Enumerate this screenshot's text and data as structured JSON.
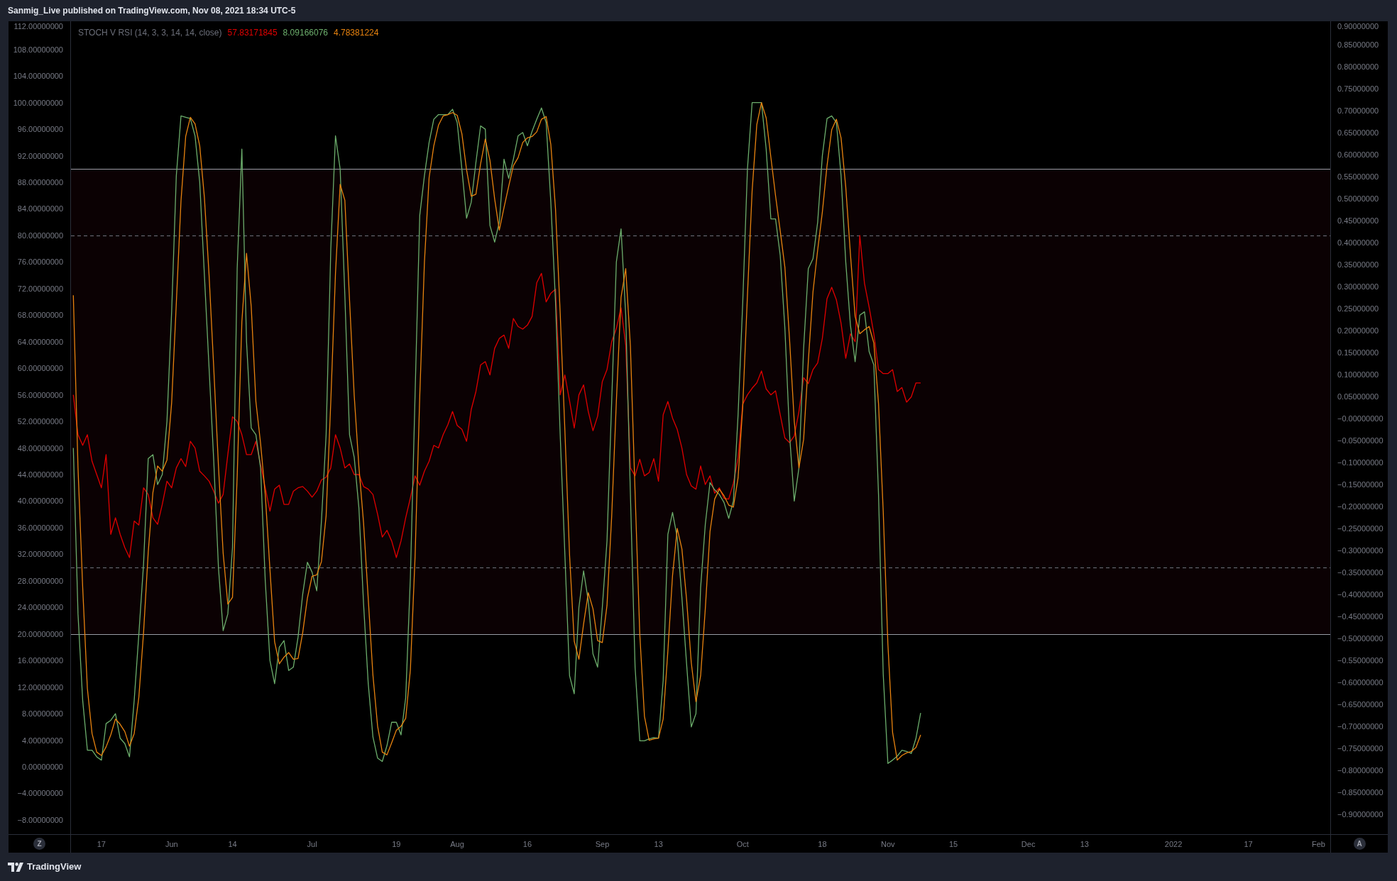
{
  "header": {
    "text": "Sanmig_Live published on TradingView.com, Nov 08, 2021 18:34 UTC-5"
  },
  "chart": {
    "legend_values": [
      "57.83171845",
      "8.09166076",
      "4.78381224"
    ],
    "axis_buttons": [
      "Z",
      "A"
    ],
    "right_scale": {
      "ticks": [
        "0.90000000",
        "0.85000000",
        "0.80000000",
        "0.75000000",
        "0.70000000",
        "0.65000000",
        "0.60000000",
        "0.55000000",
        "0.50000000",
        "0.45000000",
        "0.40000000",
        "0.35000000",
        "0.30000000",
        "0.25000000",
        "0.20000000",
        "0.15000000",
        "0.10000000",
        "0.05000000",
        "−0.00000000",
        "−0.05000000",
        "−0.10000000",
        "−0.15000000",
        "−0.20000000",
        "−0.25000000",
        "−0.30000000",
        "−0.35000000",
        "−0.40000000",
        "−0.45000000",
        "−0.50000000",
        "−0.55000000",
        "−0.60000000",
        "−0.65000000",
        "−0.70000000",
        "−0.75000000",
        "−0.80000000",
        "−0.85000000",
        "−0.90000000"
      ]
    },
    "chart_data": {
      "type": "line",
      "title": "STOCH V RSI (14, 3, 3, 14, 14, close)",
      "categories": [
        null,
        null,
        null,
        null,
        null,
        null,
        "17",
        null,
        null,
        null,
        null,
        null,
        null,
        null,
        null,
        null,
        null,
        null,
        null,
        null,
        null,
        "Jun",
        null,
        null,
        null,
        null,
        null,
        null,
        null,
        null,
        null,
        null,
        null,
        null,
        "14",
        null,
        null,
        null,
        null,
        null,
        null,
        null,
        null,
        null,
        null,
        null,
        null,
        null,
        null,
        null,
        null,
        "Jul",
        null,
        null,
        null,
        null,
        null,
        null,
        null,
        null,
        null,
        null,
        null,
        null,
        null,
        null,
        null,
        null,
        null,
        "19",
        null,
        null,
        null,
        null,
        null,
        null,
        null,
        null,
        null,
        null,
        null,
        null,
        "Aug",
        null,
        null,
        null,
        null,
        null,
        null,
        null,
        null,
        null,
        null,
        null,
        null,
        null,
        null,
        "16",
        null,
        null,
        null,
        null,
        null,
        null,
        null,
        null,
        null,
        null,
        null,
        null,
        null,
        null,
        null,
        "Sep",
        null,
        null,
        null,
        null,
        null,
        null,
        null,
        null,
        null,
        null,
        null,
        "13",
        null,
        null,
        null,
        null,
        null,
        null,
        null,
        null,
        null,
        null,
        null,
        null,
        null,
        null,
        null,
        null,
        null,
        "Oct",
        null,
        null,
        null,
        null,
        null,
        null,
        null,
        null,
        null,
        null,
        null,
        null,
        null,
        null,
        null,
        null,
        "18",
        null,
        null,
        null,
        null,
        null,
        null,
        null,
        null,
        null,
        null,
        null,
        null,
        null,
        "Nov",
        null,
        null,
        null,
        null,
        null,
        null,
        null,
        null,
        null,
        null,
        null,
        null,
        null,
        "15",
        null,
        null,
        null,
        null,
        null,
        null,
        null,
        null,
        null,
        null,
        null,
        null,
        null,
        null,
        null,
        "Dec",
        null,
        null,
        null,
        null,
        null,
        null,
        null,
        null,
        null,
        null,
        null,
        "13",
        null,
        null,
        null,
        null,
        null,
        null,
        null,
        null,
        null,
        null,
        null,
        null,
        null,
        null,
        null,
        null,
        null,
        null,
        "2022",
        null,
        null,
        null,
        null,
        null,
        null,
        null,
        null,
        null,
        null,
        null,
        null,
        null,
        null,
        null,
        "17",
        null,
        null,
        null,
        null,
        null,
        null,
        null,
        null,
        null,
        null,
        null,
        null,
        null,
        null,
        "Feb",
        null,
        null
      ],
      "series": [
        {
          "color": "#e00000",
          "values": [
            56,
            50,
            48.4,
            50,
            46,
            44,
            42,
            47,
            35,
            37.5,
            35,
            33,
            31.5,
            37,
            36.4,
            42,
            41,
            37.5,
            36.5,
            39.5,
            43,
            42,
            45,
            46.4,
            45.2,
            49,
            48,
            44.5,
            43.8,
            43,
            41.5,
            39.7,
            41,
            47,
            52.7,
            52,
            50,
            47,
            47,
            49,
            45.5,
            42,
            38.5,
            41.8,
            42.4,
            39.5,
            39.5,
            41.5,
            42,
            42.2,
            41.5,
            40.6,
            41.5,
            43.2,
            43.6,
            45,
            50,
            48,
            45,
            45.6,
            44,
            44,
            42.2,
            41.8,
            41,
            38,
            34.6,
            35.6,
            34,
            31.5,
            34,
            37.5,
            40.5,
            43.8,
            42.4,
            44.5,
            46,
            48.4,
            48,
            50,
            51.5,
            53.5,
            51.4,
            50.8,
            49,
            53.8,
            56.5,
            60.5,
            61,
            59,
            63,
            64.5,
            65,
            63,
            67.5,
            66.3,
            65.9,
            66.5,
            67.8,
            72.9,
            74.3,
            70,
            71.3,
            71.9,
            56,
            59,
            55.1,
            51,
            56,
            57.5,
            53.5,
            50.6,
            52.8,
            58,
            59.8,
            64,
            66,
            69.1,
            63.5,
            45,
            43.8,
            46.3,
            43.8,
            44.3,
            46.4,
            43,
            53,
            55,
            52.5,
            50.8,
            48,
            44,
            42.3,
            41.8,
            45.3,
            42.5,
            43.8,
            41.2,
            42,
            40.4,
            40.3,
            42.7,
            46.5,
            54.6,
            56,
            57,
            57.8,
            59.6,
            56.9,
            56,
            56.6,
            53,
            49.5,
            48.8,
            49.8,
            53.5,
            58.6,
            57.7,
            59.8,
            60.8,
            64.5,
            70.5,
            72.2,
            70.3,
            66.8,
            61.5,
            65.2,
            64,
            80,
            72.8,
            69.2,
            65.2,
            59.8,
            59.2,
            59.2,
            59.8,
            56.5,
            57.1,
            54.9,
            55.7,
            57.8,
            57.8,
            null,
            null,
            null,
            null,
            null,
            null,
            null,
            null,
            null,
            null,
            null,
            null,
            null,
            null,
            null,
            null,
            null,
            null,
            null,
            null,
            null,
            null,
            null,
            null,
            null,
            null,
            null,
            null,
            null,
            null,
            null,
            null,
            null,
            null,
            null,
            null,
            null,
            null,
            null,
            null,
            null,
            null,
            null,
            null,
            null,
            null,
            null,
            null,
            null,
            null,
            null,
            null,
            null,
            null,
            null,
            null,
            null,
            null,
            null,
            null,
            null,
            null,
            null,
            null,
            null,
            null,
            null,
            null,
            null,
            null,
            null,
            null,
            null,
            null,
            null,
            null,
            null,
            null,
            null,
            null,
            null,
            null,
            null,
            null,
            null,
            null,
            null
          ]
        },
        {
          "color": "#6cae6c",
          "values": [
            48,
            23,
            10,
            2.5,
            2.5,
            1.5,
            1,
            6.5,
            7,
            8,
            4.3,
            3.5,
            1.5,
            10,
            20,
            30.5,
            46.4,
            47,
            42.5,
            44,
            52,
            68.5,
            89,
            98,
            97.8,
            97.6,
            95,
            88,
            74,
            60,
            46,
            30,
            20.5,
            23,
            33,
            75,
            93,
            64,
            51,
            50,
            45,
            28,
            16,
            12.5,
            18,
            19,
            14.5,
            15,
            19.5,
            26,
            30.8,
            29.3,
            26.5,
            37,
            50,
            78,
            95,
            90,
            71,
            50,
            46.6,
            39,
            24.5,
            12.5,
            4.5,
            1.3,
            0.8,
            3.2,
            6.7,
            6.7,
            4.8,
            10.4,
            28.5,
            56,
            83,
            89,
            94,
            97.5,
            98.2,
            98.2,
            98.2,
            99,
            97,
            90,
            82.6,
            85,
            91,
            96.5,
            96,
            81.5,
            79,
            82,
            91.5,
            88.6,
            91.5,
            95,
            95.5,
            93.5,
            95.7,
            97.5,
            99.2,
            97,
            85,
            70,
            50,
            32,
            13.7,
            11,
            24,
            29.5,
            25,
            17,
            15,
            24,
            34,
            55,
            76,
            81,
            68,
            41,
            15,
            3.9,
            3.9,
            4.2,
            4.4,
            4.3,
            13,
            35,
            38.3,
            34.5,
            25.5,
            15.5,
            6,
            8,
            27,
            36.5,
            42.8,
            41.7,
            41,
            39.8,
            37.4,
            40,
            53,
            70,
            90,
            100,
            100,
            100,
            93,
            82.5,
            82.5,
            77,
            66,
            50,
            40,
            45,
            63,
            75,
            76.5,
            82,
            92,
            97.6,
            98,
            97,
            89,
            76,
            66.5,
            61,
            68,
            68.5,
            62.5,
            60.5,
            41,
            14,
            0.5,
            1,
            1.6,
            2.5,
            2.3,
            2,
            4.3,
            8.1,
            null,
            null,
            null,
            null,
            null,
            null,
            null,
            null,
            null,
            null,
            null,
            null,
            null,
            null,
            null,
            null,
            null,
            null,
            null,
            null,
            null,
            null,
            null,
            null,
            null,
            null,
            null,
            null,
            null,
            null,
            null,
            null,
            null,
            null,
            null,
            null,
            null,
            null,
            null,
            null,
            null,
            null,
            null,
            null,
            null,
            null,
            null,
            null,
            null,
            null,
            null,
            null,
            null,
            null,
            null,
            null,
            null,
            null,
            null,
            null,
            null,
            null,
            null,
            null,
            null,
            null,
            null,
            null,
            null,
            null,
            null,
            null,
            null,
            null,
            null,
            null,
            null,
            null,
            null,
            null,
            null,
            null,
            null,
            null,
            null,
            null,
            null
          ]
        },
        {
          "color": "#e8830f",
          "values": [
            71,
            45,
            27,
            11.8,
            5,
            2.2,
            1.7,
            3,
            4.8,
            7.2,
            6.4,
            5.3,
            3.1,
            5,
            10.5,
            20.2,
            32.3,
            41.3,
            45.3,
            44.5,
            46.2,
            54.8,
            69.8,
            85.2,
            94.9,
            97.8,
            96.8,
            93.5,
            85.7,
            74,
            60,
            45.3,
            32.2,
            24.5,
            25.5,
            43.7,
            67,
            77.3,
            69.3,
            55,
            48.7,
            41,
            29.7,
            18.8,
            15.5,
            16.5,
            17.2,
            16.2,
            16.3,
            20.2,
            25.4,
            28.7,
            28.9,
            30.9,
            37.8,
            55,
            74.3,
            87.7,
            85.3,
            70.3,
            55.9,
            45.2,
            36.7,
            25.3,
            13.8,
            6.1,
            2.2,
            1.8,
            3.6,
            5.5,
            6.1,
            7.3,
            14.6,
            31.6,
            55.8,
            76,
            88.7,
            93.5,
            96.6,
            98,
            98.2,
            98.5,
            98.1,
            95.3,
            89.9,
            85.9,
            86.2,
            90.8,
            94.5,
            91.3,
            85.5,
            80.8,
            84.2,
            87.4,
            90.5,
            91.7,
            94,
            94.7,
            94.9,
            95.6,
            97.5,
            97.9,
            93.7,
            84,
            68.3,
            50.7,
            31.9,
            18.9,
            16.2,
            21.5,
            26.2,
            23.8,
            19,
            18.7,
            24.3,
            37.7,
            55,
            70.7,
            75,
            63.3,
            41.3,
            20,
            7.6,
            4,
            4.2,
            4.3,
            7.2,
            17.4,
            28.8,
            35.9,
            32.8,
            25.2,
            15.7,
            9.8,
            13.7,
            23.8,
            35.4,
            40.3,
            41.8,
            40.8,
            39.4,
            39.1,
            43.5,
            54.3,
            71,
            86.7,
            96.7,
            100,
            97.7,
            91.8,
            86,
            80.7,
            75.2,
            64.3,
            52,
            45,
            49.3,
            61,
            71.5,
            77.8,
            83.5,
            90.5,
            95.9,
            97.5,
            94.7,
            87.3,
            77.2,
            67.8,
            65.2,
            65.8,
            66.3,
            63.8,
            54.7,
            38.5,
            18.5,
            5.2,
            1,
            1.7,
            2.1,
            2.3,
            2.9,
            4.8,
            null,
            null,
            null,
            null,
            null,
            null,
            null,
            null,
            null,
            null,
            null,
            null,
            null,
            null,
            null,
            null,
            null,
            null,
            null,
            null,
            null,
            null,
            null,
            null,
            null,
            null,
            null,
            null,
            null,
            null,
            null,
            null,
            null,
            null,
            null,
            null,
            null,
            null,
            null,
            null,
            null,
            null,
            null,
            null,
            null,
            null,
            null,
            null,
            null,
            null,
            null,
            null,
            null,
            null,
            null,
            null,
            null,
            null,
            null,
            null,
            null,
            null,
            null,
            null,
            null,
            null,
            null,
            null,
            null,
            null,
            null,
            null,
            null,
            null,
            null,
            null,
            null,
            null,
            null,
            null,
            null,
            null,
            null,
            null,
            null,
            null,
            null
          ]
        }
      ],
      "ylim": [
        -10.15,
        112.25
      ],
      "yticks": [
        {
          "value": 112,
          "label": "112.00000000"
        },
        {
          "value": 108,
          "label": "108.00000000"
        },
        {
          "value": 104,
          "label": "104.00000000"
        },
        {
          "value": 100,
          "label": "100.00000000"
        },
        {
          "value": 96,
          "label": "96.00000000"
        },
        {
          "value": 92,
          "label": "92.00000000"
        },
        {
          "value": 88,
          "label": "88.00000000"
        },
        {
          "value": 84,
          "label": "84.00000000"
        },
        {
          "value": 80,
          "label": "80.00000000"
        },
        {
          "value": 76,
          "label": "76.00000000"
        },
        {
          "value": 72,
          "label": "72.00000000"
        },
        {
          "value": 68,
          "label": "68.00000000"
        },
        {
          "value": 64,
          "label": "64.00000000"
        },
        {
          "value": 60,
          "label": "60.00000000"
        },
        {
          "value": 56,
          "label": "56.00000000"
        },
        {
          "value": 52,
          "label": "52.00000000"
        },
        {
          "value": 48,
          "label": "48.00000000"
        },
        {
          "value": 44,
          "label": "44.00000000"
        },
        {
          "value": 40,
          "label": "40.00000000"
        },
        {
          "value": 36,
          "label": "36.00000000"
        },
        {
          "value": 32,
          "label": "32.00000000"
        },
        {
          "value": 28,
          "label": "28.00000000"
        },
        {
          "value": 24,
          "label": "24.00000000"
        },
        {
          "value": 20,
          "label": "20.00000000"
        },
        {
          "value": 16,
          "label": "16.00000000"
        },
        {
          "value": 12,
          "label": "12.00000000"
        },
        {
          "value": 8,
          "label": "8.00000000"
        },
        {
          "value": 4,
          "label": "4.00000000"
        },
        {
          "value": 0,
          "label": "0.00000000"
        },
        {
          "value": -4,
          "label": "−4.00000000"
        },
        {
          "value": -8,
          "label": "−8.00000000"
        }
      ],
      "bands": [
        {
          "axis": "y",
          "from": 20,
          "to": 90
        }
      ],
      "ref_lines": [
        {
          "axis": "y",
          "value": 90
        },
        {
          "axis": "y",
          "value": 80
        },
        {
          "axis": "y",
          "value": 30
        },
        {
          "axis": "y",
          "value": 20
        }
      ]
    }
  },
  "footer": {
    "brand": "TradingView"
  }
}
